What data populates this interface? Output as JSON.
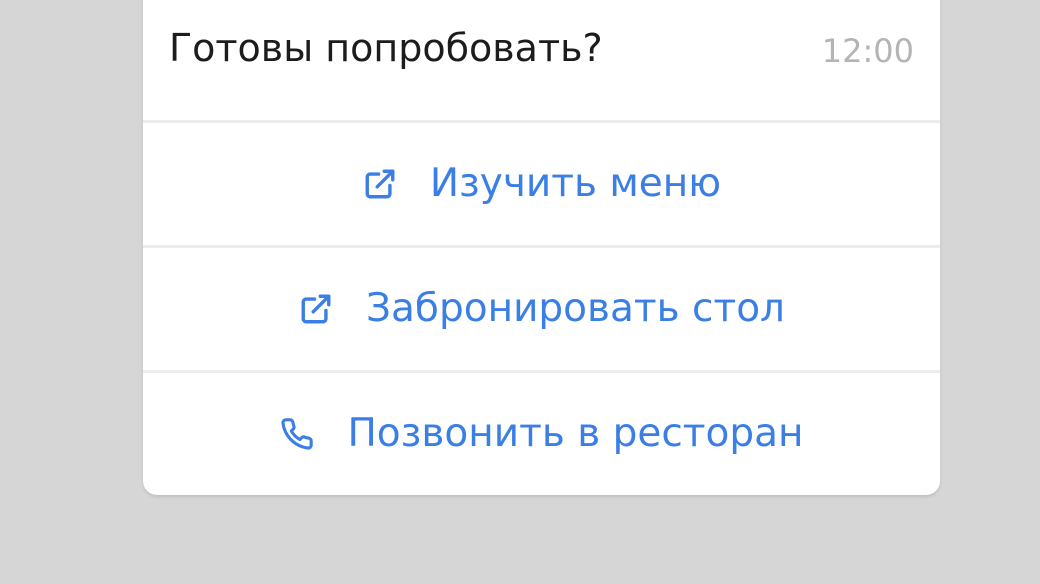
{
  "message": {
    "text": "Готовы попробовать?",
    "time": "12:00"
  },
  "actions": [
    {
      "label": "Изучить меню",
      "icon": "external-link-icon"
    },
    {
      "label": "Забронировать стол",
      "icon": "external-link-icon"
    },
    {
      "label": "Позвонить в ресторан",
      "icon": "phone-icon"
    }
  ],
  "colors": {
    "background": "#d6d6d6",
    "card": "#ffffff",
    "text": "#1c1c1c",
    "time": "#b4b4b4",
    "accent": "#3b7fe6",
    "divider": "#ececec"
  }
}
